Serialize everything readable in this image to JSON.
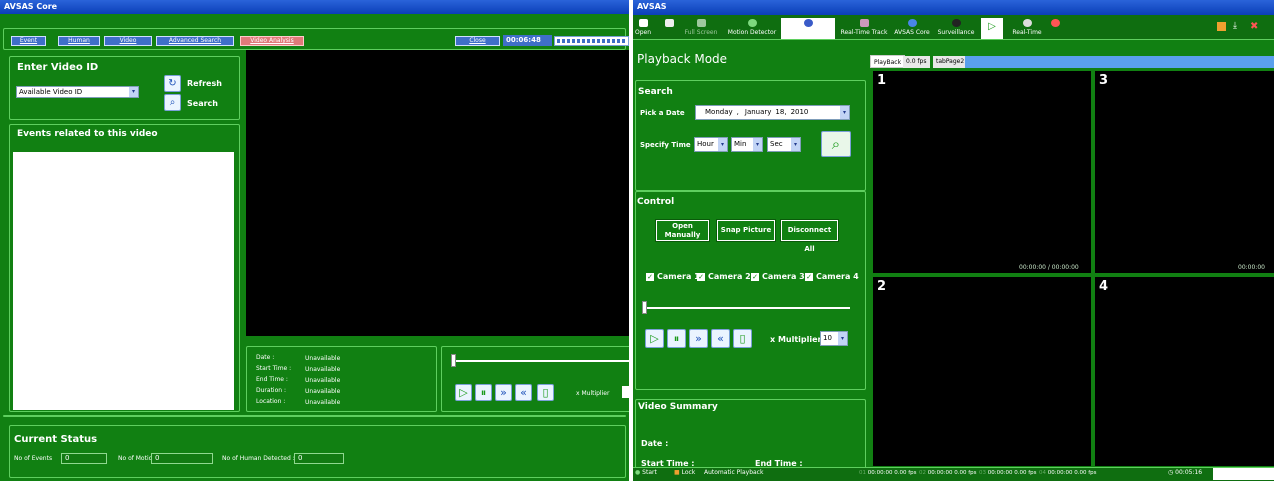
{
  "left_window": {
    "title": "AVSAS Core",
    "nav_buttons": [
      "Event",
      "Human",
      "Video",
      "Advanced Search"
    ],
    "active_tab": "Video Analysis",
    "close_label": "Close",
    "time": "00:06:48",
    "enter_video": {
      "heading": "Enter Video ID",
      "select_value": "Available Video ID",
      "refresh": "Refresh",
      "search": "Search"
    },
    "events_heading": "Events related to this video",
    "info": {
      "labels": [
        "Date :",
        "Start Time :",
        "End Time :",
        "Duration :",
        "Location :"
      ],
      "values": [
        "Unavailable",
        "Unavailable",
        "Unavailable",
        "Unavailable",
        "Unavailable"
      ]
    },
    "multiplier_label": "x Multiplier",
    "status": {
      "heading": "Current Status",
      "events_label": "No of  Events",
      "events_value": "0",
      "motions_label": "No of Motions",
      "motions_value": "0",
      "human_label": "No of Human Detected :",
      "human_value": "0"
    }
  },
  "right_window": {
    "title": "AVSAS",
    "toolbar": [
      "Open",
      "",
      "Full Screen",
      "Motion Detector",
      "",
      "Real-Time Track",
      "AVSAS Core",
      "Surveillance",
      "",
      "Real-Time",
      ""
    ],
    "mode_title": "Playback Mode",
    "tabs": [
      "PlayBack",
      "0.0 fps",
      "tabPage2"
    ],
    "search": {
      "heading": "Search",
      "pick_date": "Pick a Date",
      "date_day": "Monday",
      "date_sep": ",",
      "date_month": "January",
      "date_daynum": "18,",
      "date_year": "2010",
      "specify_time": "Specify Time",
      "hour": "Hour",
      "min": "Min",
      "sec": "Sec"
    },
    "control": {
      "heading": "Control",
      "open_manually": "Open Manually",
      "snap": "Snap Picture",
      "disconnect": "Disconnect All",
      "cameras": [
        "Camera 1",
        "Camera 2",
        "Camera 3",
        "Camera 4"
      ],
      "multiplier_label": "x Multiplier",
      "multiplier_value": "10"
    },
    "summary": {
      "heading": "Video Summary",
      "date": "Date :",
      "start": "Start Time :",
      "end": "End Time :"
    },
    "quadrants": [
      "1",
      "3",
      "2",
      "4"
    ],
    "timestamp": "00:00:00  /  00:00:00",
    "timestamp_short": "00:00:00",
    "statusbar": {
      "start": "Start",
      "lock": "Lock",
      "auto": "Automatic Playback",
      "cams": [
        "01",
        "02",
        "03",
        "04"
      ],
      "cam_time": "00:00:00",
      "cam_fps": "0.00 fps",
      "clock": "00:05:16"
    }
  }
}
